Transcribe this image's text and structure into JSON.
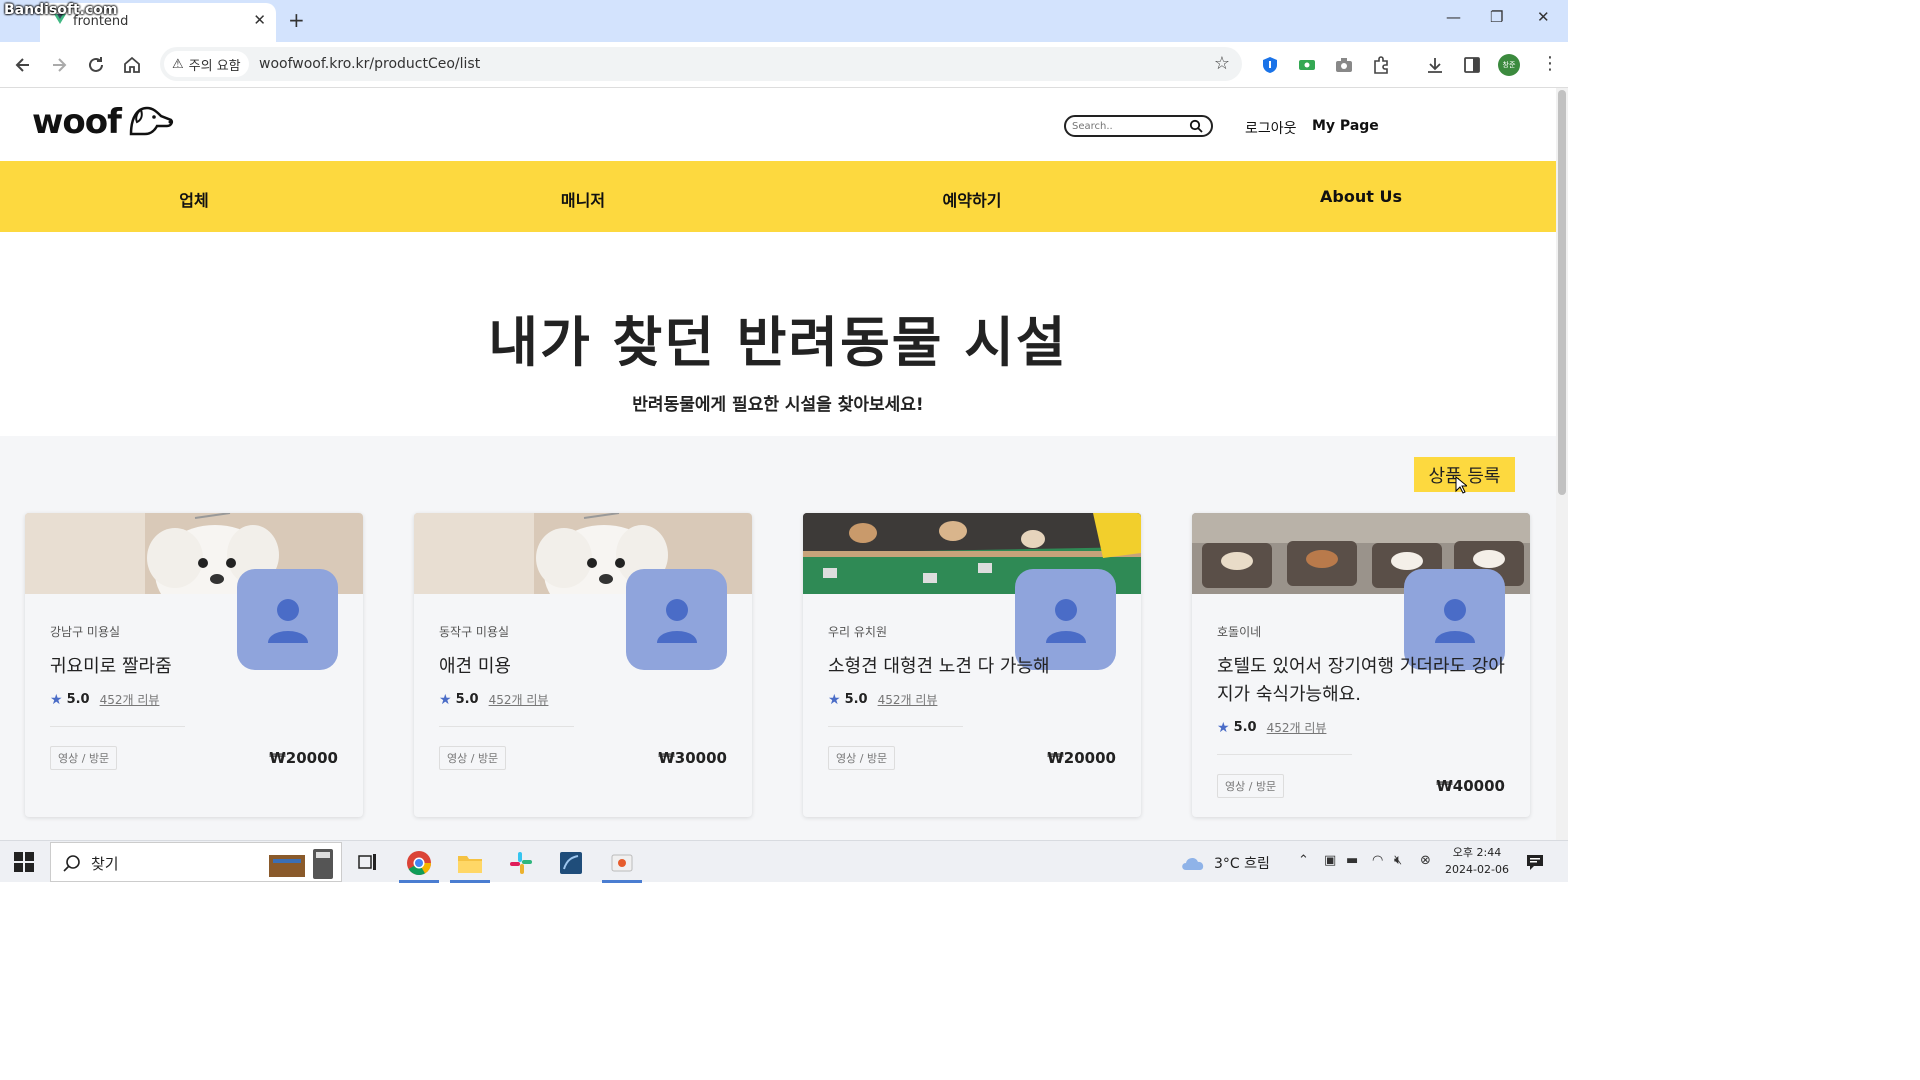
{
  "watermark": "Bandisoft.com",
  "browser": {
    "tab_title": "frontend",
    "security_chip": "주의 요함",
    "url": "woofwoof.kro.kr/productCeo/list",
    "profile_label": "창준"
  },
  "header": {
    "logo_text": "woof",
    "search_placeholder": "Search..",
    "logout": "로그아웃",
    "mypage": "My Page"
  },
  "nav": {
    "items": [
      {
        "label": "업체"
      },
      {
        "label": "매니저"
      },
      {
        "label": "예약하기"
      },
      {
        "label": "About Us"
      }
    ]
  },
  "hero": {
    "title": "내가 찾던 반려동물 시설",
    "subtitle": "반려동물에게 필요한 시설을 찾아보세요!"
  },
  "list": {
    "register_button": "상품 등록",
    "cards": [
      {
        "category": "강남구 미용실",
        "title": "귀요미로 짤라줌",
        "rating": "5.0",
        "reviews": "452개 리뷰",
        "tag": "영상 / 방문",
        "price": "₩20000",
        "image": "white-maltese-dog"
      },
      {
        "category": "동작구 미용실",
        "title": "애견 미용",
        "rating": "5.0",
        "reviews": "452개 리뷰",
        "tag": "영상 / 방문",
        "price": "₩30000",
        "image": "white-maltese-dog"
      },
      {
        "category": "우리 유치원",
        "title": "소형견 대형견 노견 다 가능해",
        "rating": "5.0",
        "reviews": "452개 리뷰",
        "tag": "영상 / 방문",
        "price": "₩20000",
        "image": "dog-kindergarten-playroom"
      },
      {
        "category": "호돌이네",
        "title": "호텔도 있어서 장기여행 가더라도 강아지가 숙식가능해요.",
        "rating": "5.0",
        "reviews": "452개 리뷰",
        "tag": "영상 / 방문",
        "price": "₩40000",
        "image": "dogs-sleeping-on-beds"
      }
    ]
  },
  "taskbar": {
    "search_text": "찾기",
    "weather": "3°C  흐림",
    "time": "오후 2:44",
    "date": "2024-02-06"
  },
  "colors": {
    "nav_yellow": "#fdd93f",
    "avatar_blue": "#8fa4dc",
    "list_bg": "#f5f6f8"
  }
}
